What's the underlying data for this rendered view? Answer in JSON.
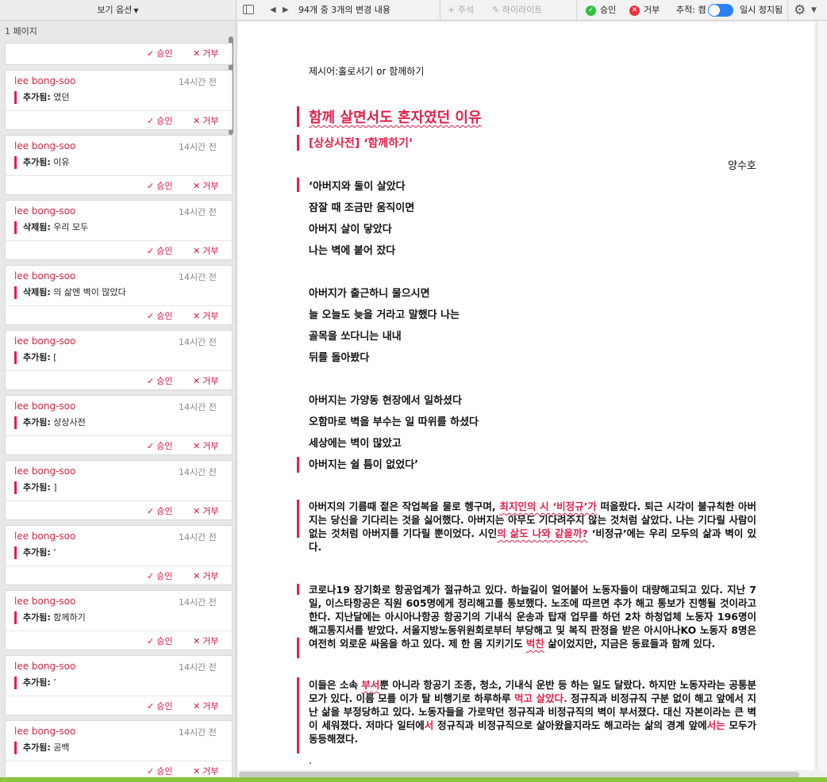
{
  "sidebar": {
    "view_options": "보기 옵션",
    "page_label": "1 페이지",
    "approve_label": "승인",
    "reject_label": "거부",
    "cards": [
      {
        "author": "lee bong-soo",
        "time": "14시간 전",
        "kind": "추가됨:",
        "text": "였던"
      },
      {
        "author": "lee bong-soo",
        "time": "14시간 전",
        "kind": "추가됨:",
        "text": " 이유"
      },
      {
        "author": "lee bong-soo",
        "time": "14시간 전",
        "kind": "삭제됨:",
        "text": "우리 모두"
      },
      {
        "author": "lee bong-soo",
        "time": "14시간 전",
        "kind": "삭제됨:",
        "text": "의 삶엔 벽이 많았다"
      },
      {
        "author": "lee bong-soo",
        "time": "14시간 전",
        "kind": "추가됨:",
        "text": "["
      },
      {
        "author": "lee bong-soo",
        "time": "14시간 전",
        "kind": "추가됨:",
        "text": "상상사전"
      },
      {
        "author": "lee bong-soo",
        "time": "14시간 전",
        "kind": "추가됨:",
        "text": "]"
      },
      {
        "author": "lee bong-soo",
        "time": "14시간 전",
        "kind": "추가됨:",
        "text": " ‘"
      },
      {
        "author": "lee bong-soo",
        "time": "14시간 전",
        "kind": "추가됨:",
        "text": "함께하기"
      },
      {
        "author": "lee bong-soo",
        "time": "14시간 전",
        "kind": "추가됨:",
        "text": "’"
      },
      {
        "author": "lee bong-soo",
        "time": "14시간 전",
        "kind": "추가됨:",
        "text": "공백"
      }
    ]
  },
  "toolbar": {
    "change_count": "94개 중 3개의 변경 내용",
    "add_comment": "+ 주석",
    "highlight": "하이라이트",
    "accept": "승인",
    "reject": "거부",
    "track_label": "추적: 켬",
    "pause": "일시 정지됨"
  },
  "doc": {
    "prompt": "제시어:홀로서기 or 함께하기",
    "title": "함께 살면서도 혼자였던 이유",
    "subtitle": "[상상사전] ‘함께하기’",
    "author": "양수호",
    "stanza1": [
      "‘아버지와 둘이 살았다",
      "잠잘 때 조금만 움직이면",
      "아버지 살이 닿았다",
      "나는 벽에 붙어 잤다"
    ],
    "stanza2": [
      "아버지가 출근하니 물으시면",
      "늘 오늘도 늦을 거라고 말했다 나는",
      "골목을 쏘다니는 내내",
      "뒤를 돌아봤다"
    ],
    "stanza3": [
      "아버지는 가양동 현장에서 일하셨다",
      "오함마로 벽을 부수는 일 따위를 하셨다",
      "세상에는 벽이 많았고",
      "아버지는 쉴 틈이 없었다’"
    ],
    "para1": {
      "a": "아버지의 기름때 젙은 작업복을 물로 헹구며, ",
      "b": "최지인의 시 ‘비정규’가",
      "c": " 떠올랐다. 퇴근 시각이 불규칙한 아버지는 당신을 기다리는 것을 싫어했다. 아버지는 아무도 기다려주지 않는 것처럼 살았다. 나는 기다릴 사람이 없는 것처럼 아버지를 기다릴 뿐이었다. 시인",
      "d": "의 삶도 나와 같을까?",
      "e": " ‘비정규’에는 우리 모두의 삶과 벽이 있다."
    },
    "para2": {
      "a": "코로나19 장기화로 항공업계가 절규하고 있다. 하늘길이 얼어붙어 노동자들이 대량해고되고 있다. 지난 7일, 이스타항공은 직원 605명에게 정리해고를 통보했다. 노조에 따르면 추가 해고 통보가 진행될 것이라고 한다. 지난달에는 아시아나항공 항공기의 기내식 운송과 탑재 업무를 하던 2차 하청업체 노동자 196명이 해고통지서를 받았다. 서울지방노동위원회로부터 부당해고 및 복직 판정을 받은 아시아나KO 노동자 8명은 여전히 외로운 싸움을 하고 있다. 제 한 몸 지키기도 ",
      "b": "벅찬",
      "c": " 삶이었지만, 지금은 동료들과 함께 있다."
    },
    "para3": {
      "a": "이들은 소속 ",
      "b": "부서",
      "c": "뿐 아니라 항공기 조종, 청소, 기내식 운반 등 하는 일도 달랐다. 하지만 노동자라는 공통분모가 있다. 이름 모를 이가 탈 비행기로 하루하루 ",
      "d": "먹고 살았다.",
      "e": " 정규직과 비정규직 구분 없이 해고 앞에서 지난 삶을 부정당하고 있다. 노동자들을 가로막던 정규직과 비정규직의 벽이 부서졌다. 대신 자본이라는 큰 벽이 세워졌다. 저마다 일터에",
      "f": "서",
      "g": " 정규직과 비정규직으로 살아왔을지라도 해고라는 삶의 경계 앞에",
      "h": "서는",
      "i": " 모두가 동등해졌다."
    },
    "trailing": "."
  },
  "colors": {
    "accent": "#e0214a",
    "author": "#cc2a46",
    "approve": "#2fbf3b",
    "reject": "#e8303f",
    "toggle": "#2a7ff5"
  },
  "icons": {
    "approve": "check-icon",
    "reject": "x-icon",
    "gear": "gear-icon",
    "sidebar": "sidebar-toggle-icon"
  }
}
